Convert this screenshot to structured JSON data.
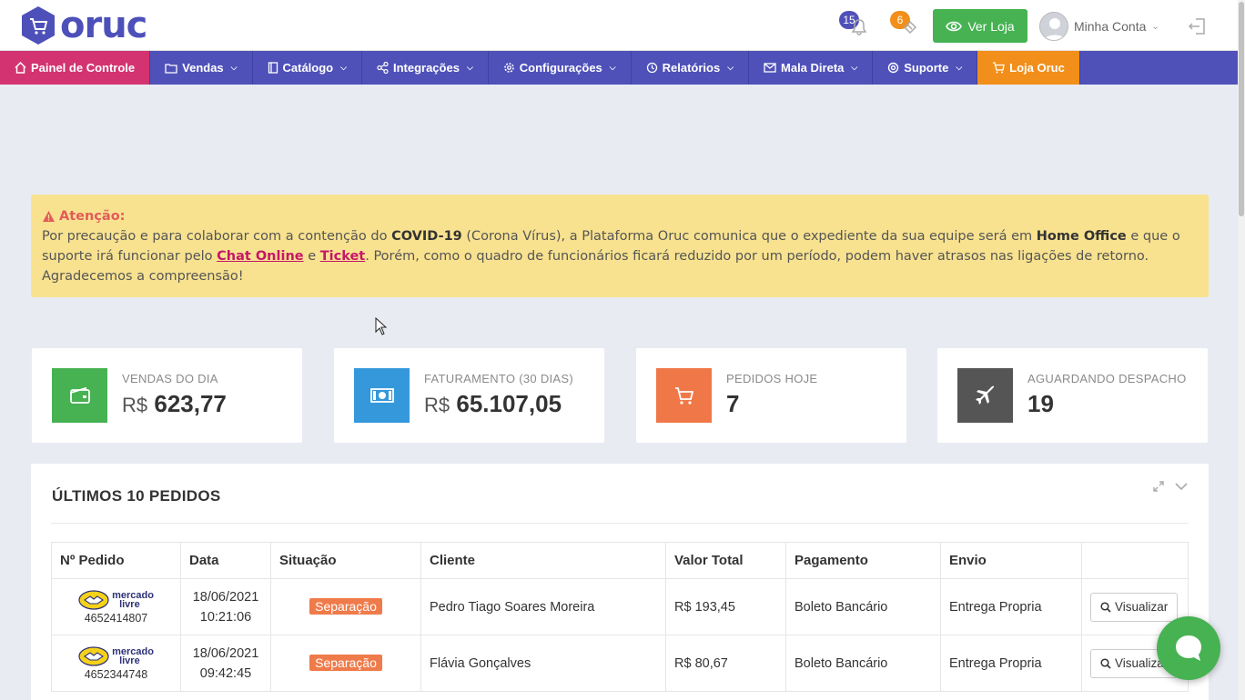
{
  "brand": {
    "name": "oruc",
    "color": "#4d50b9"
  },
  "header": {
    "notifications_count": "15",
    "tickets_count": "6",
    "ver_loja_label": "Ver Loja",
    "account_label": "Minha Conta"
  },
  "nav": {
    "items": [
      {
        "label": "Painel de Controle",
        "icon": "home-icon"
      },
      {
        "label": "Vendas",
        "icon": "folder-icon"
      },
      {
        "label": "Catálogo",
        "icon": "book-icon"
      },
      {
        "label": "Integrações",
        "icon": "share-icon"
      },
      {
        "label": "Configurações",
        "icon": "gear-icon"
      },
      {
        "label": "Relatórios",
        "icon": "history-icon"
      },
      {
        "label": "Mala Direta",
        "icon": "envelope-icon"
      },
      {
        "label": "Suporte",
        "icon": "lifebuoy-icon"
      },
      {
        "label": "Loja Oruc",
        "icon": "cart-icon"
      }
    ]
  },
  "alert": {
    "title": "Atenção:",
    "p1": "Por precaução e para colaborar com a contenção do ",
    "covid": "COVID-19",
    "p2": " (Corona Vírus), a Plataforma Oruc comunica que o expediente da sua equipe será em ",
    "home_office": "Home Office",
    "p3": " e que o suporte irá funcionar pelo ",
    "chat": "Chat Online",
    "p4": " e ",
    "ticket": "Ticket",
    "p5": ". Porém, como o quadro de funcionários ficará reduzido por um período, podem haver atrasos nas ligações de retorno. Agradecemos a compreensão!"
  },
  "stats": [
    {
      "label": "VENDAS DO DIA",
      "currency": "R$",
      "value": "623,77",
      "color": "#46b252",
      "icon": "wallet-icon"
    },
    {
      "label": "FATURAMENTO (30 DIAS)",
      "currency": "R$",
      "value": "65.107,05",
      "color": "#3498db",
      "icon": "money-icon"
    },
    {
      "label": "PEDIDOS HOJE",
      "currency": "",
      "value": "7",
      "color": "#f07848",
      "icon": "cart-icon"
    },
    {
      "label": "AGUARDANDO DESPACHO",
      "currency": "",
      "value": "19",
      "color": "#555555",
      "icon": "plane-icon"
    }
  ],
  "orders": {
    "title": "ÚLTIMOS 10 PEDIDOS",
    "columns": [
      "Nº Pedido",
      "Data",
      "Situação",
      "Cliente",
      "Valor Total",
      "Pagamento",
      "Envio",
      ""
    ],
    "marketplace_line1": "mercado",
    "marketplace_line2": "livre",
    "view_label": "Visualizar",
    "rows": [
      {
        "id": "4652414807",
        "date": "18/06/2021",
        "time": "10:21:06",
        "status": "Separação",
        "client": "Pedro Tiago Soares Moreira",
        "total": "R$ 193,45",
        "payment": "Boleto Bancário",
        "shipping": "Entrega Propria"
      },
      {
        "id": "4652344748",
        "date": "18/06/2021",
        "time": "09:42:45",
        "status": "Separação",
        "client": "Flávia Gonçalves",
        "total": "R$ 80,67",
        "payment": "Boleto Bancário",
        "shipping": "Entrega Propria"
      }
    ]
  }
}
